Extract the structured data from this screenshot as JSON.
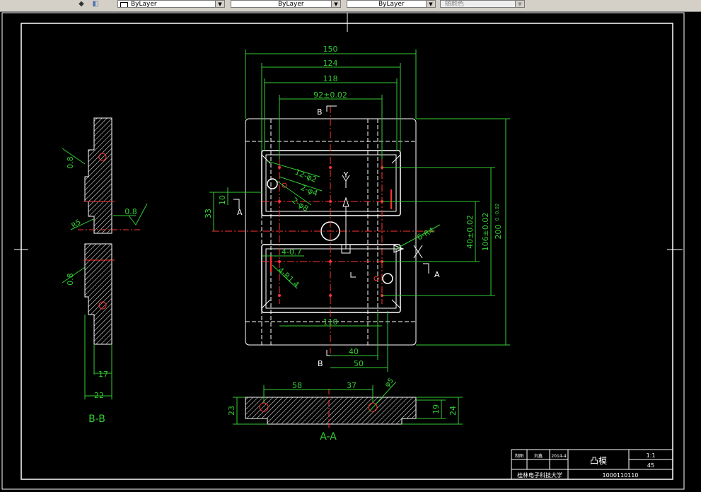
{
  "toolbar": {
    "layer_combo": "ByLayer",
    "linetype_combo": "ByLayer",
    "lineweight_combo": "ByLayer",
    "plotstyle_combo": "随颜色"
  },
  "dims": {
    "w150": "150",
    "w124": "124",
    "w118": "118",
    "w92": "92±0.02",
    "h200": "200",
    "h200_tol": "0 -0.02",
    "h106": "106±0.02",
    "h40": "40±0.02",
    "d33": "33",
    "d10": "10",
    "d110": "110",
    "d40": "40",
    "d50": "50",
    "holes1": "12-φ2",
    "holes2": "2-φ4",
    "holes3": "2-φ8",
    "r6": "6-R4",
    "t07": "4-0.7",
    "r14": "4-R1.4",
    "aa58": "58",
    "aa37": "37",
    "aa_phi": "φ5",
    "aa23": "23",
    "aa19": "19",
    "aa24": "24",
    "bb17": "17",
    "bb22": "22",
    "r08a": "0.8",
    "r08b": "0.8",
    "r08c": "0.8",
    "r08d": "0.8",
    "r5": "R5"
  },
  "labels": {
    "section_b_top": "B",
    "section_b_bottom": "B",
    "section_a_right": "A",
    "section_a_left": "A",
    "view_bb": "B-B",
    "view_aa": "A-A",
    "axis_y": "Y"
  },
  "title_block": {
    "part_name": "凸模",
    "scale": "1:1",
    "material": "45",
    "school": "桂林电子科技大学",
    "drawing_no": "1000110110",
    "row1_a": "制图",
    "row1_b": "刘鑫",
    "row1_c": "2014-4"
  }
}
